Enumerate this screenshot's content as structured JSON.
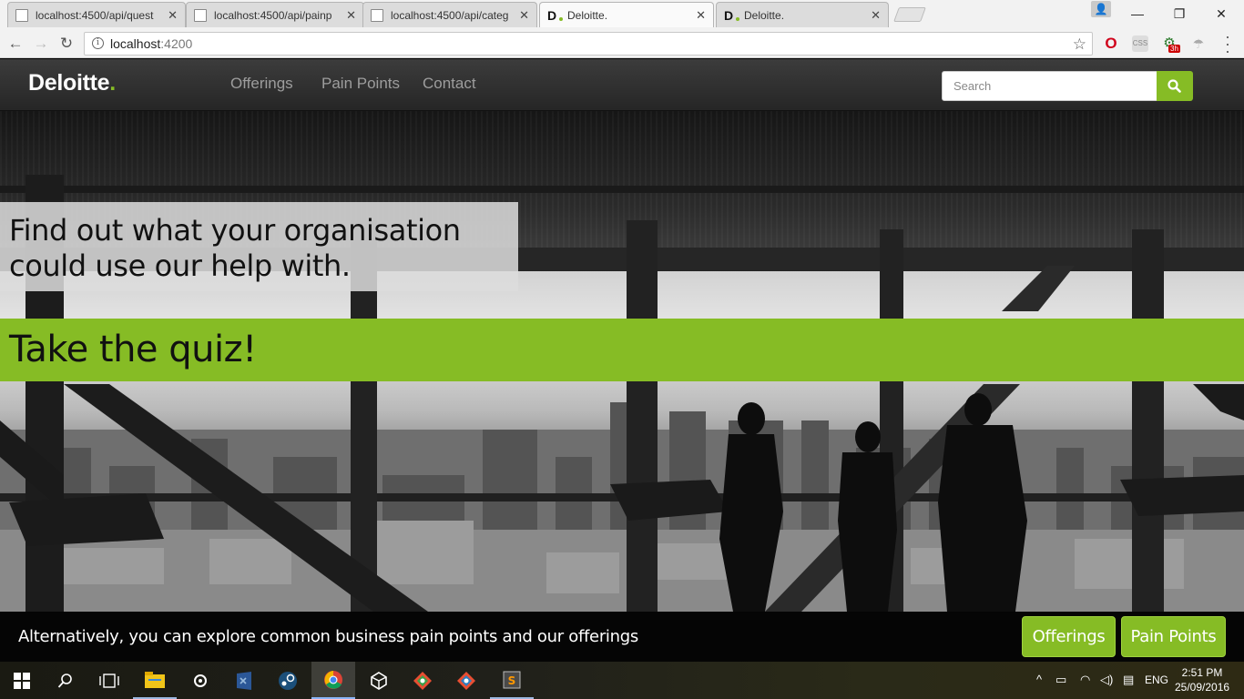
{
  "browser": {
    "tabs": [
      {
        "title": "localhost:4500/api/quest",
        "active": false,
        "favicon": "document-icon"
      },
      {
        "title": "localhost:4500/api/painp",
        "active": false,
        "favicon": "document-icon"
      },
      {
        "title": "localhost:4500/api/categ",
        "active": false,
        "favicon": "document-icon"
      },
      {
        "title": "Deloitte.",
        "active": true,
        "favicon": "deloitte-d-icon"
      },
      {
        "title": "Deloitte.",
        "active": false,
        "favicon": "deloitte-d-icon"
      }
    ],
    "url_host": "localhost",
    "url_port": ":4200",
    "extension_badge": "3h"
  },
  "site": {
    "brand": "Deloitte",
    "brand_dot": ".",
    "nav": [
      {
        "label": "Offerings"
      },
      {
        "label": "Pain Points"
      },
      {
        "label": "Contact"
      }
    ],
    "search_placeholder": "Search",
    "colors": {
      "accent": "#86bc25",
      "navbar": "#2e2e2e"
    }
  },
  "hero": {
    "tagline_line1": "Find out what your organisation",
    "tagline_line2": "could use our help with.",
    "cta": "Take the quiz!"
  },
  "footer": {
    "text": "Alternatively, you can explore common business pain points and our offerings",
    "buttons": [
      {
        "label": "Offerings"
      },
      {
        "label": "Pain Points"
      }
    ]
  },
  "taskbar": {
    "language": "ENG",
    "time": "2:51 PM",
    "date": "25/09/2016"
  }
}
